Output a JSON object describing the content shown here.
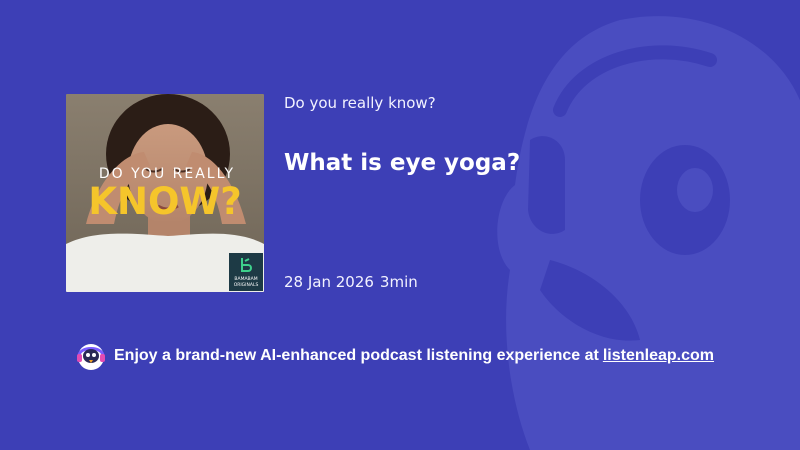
{
  "colors": {
    "background": "#3d3fb6",
    "cover_text": "#f5c52b",
    "badge": "#1d3a45",
    "badge_accent": "#3ed18c"
  },
  "cover": {
    "line1": "DO YOU REALLY",
    "line2": "KNOW?",
    "badge_line1": "BAMABAM",
    "badge_line2": "ORIGINALS"
  },
  "episode": {
    "show_title": "Do you really know?",
    "title": "What is eye yoga?",
    "date": "28 Jan 2026",
    "duration": "3min"
  },
  "promo": {
    "text": "Enjoy a brand-new AI-enhanced podcast listening experience at",
    "link_text": "listenleap.com"
  },
  "icons": {
    "promo_icon": "penguin-headphones-icon",
    "background_icon": "penguin-mascot-icon"
  }
}
